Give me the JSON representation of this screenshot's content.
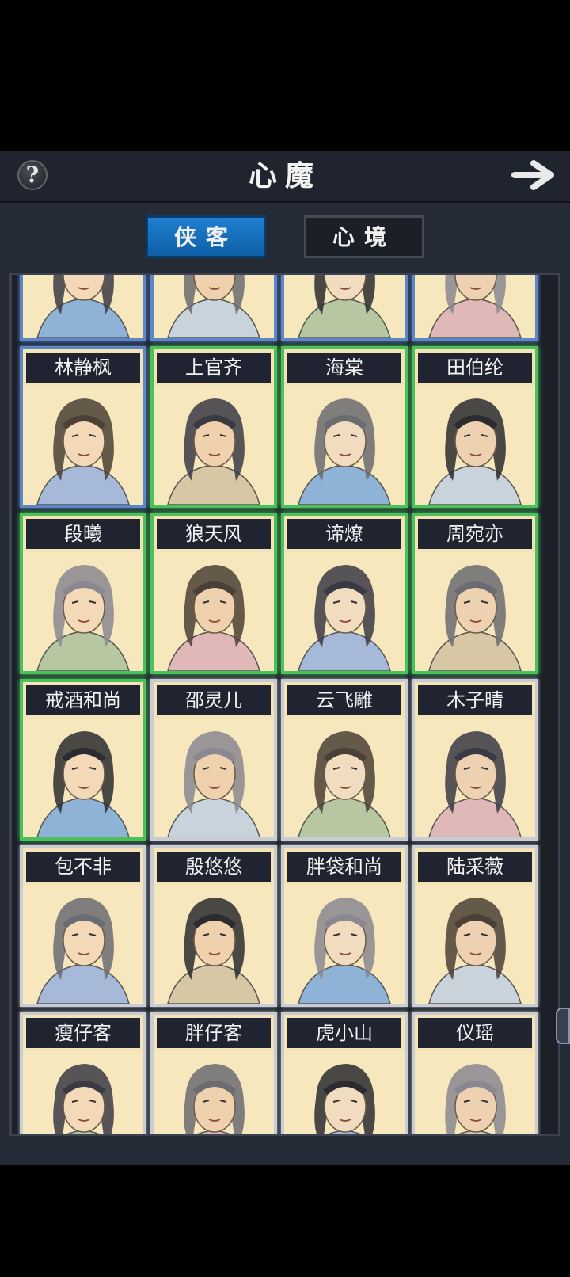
{
  "header": {
    "title": "心魔",
    "help_icon": "question-icon",
    "next_icon": "arrow-right-icon",
    "help_label": "?"
  },
  "tabs": [
    {
      "label": "侠客",
      "active": true
    },
    {
      "label": "心境",
      "active": false
    }
  ],
  "characters": [
    {
      "name": "",
      "frame": "blue"
    },
    {
      "name": "",
      "frame": "blue"
    },
    {
      "name": "",
      "frame": "blue"
    },
    {
      "name": "",
      "frame": "blue"
    },
    {
      "name": "林静枫",
      "frame": "blue"
    },
    {
      "name": "上官齐",
      "frame": "green"
    },
    {
      "name": "海棠",
      "frame": "green"
    },
    {
      "name": "田伯纶",
      "frame": "green"
    },
    {
      "name": "段曦",
      "frame": "green"
    },
    {
      "name": "狼天风",
      "frame": "green"
    },
    {
      "name": "谛燎",
      "frame": "green"
    },
    {
      "name": "周宛亦",
      "frame": "green"
    },
    {
      "name": "戒酒和尚",
      "frame": "green"
    },
    {
      "name": "邵灵儿",
      "frame": "gray"
    },
    {
      "name": "云飞雕",
      "frame": "gray"
    },
    {
      "name": "木子晴",
      "frame": "gray"
    },
    {
      "name": "包不非",
      "frame": "gray"
    },
    {
      "name": "殷悠悠",
      "frame": "gray"
    },
    {
      "name": "胖袋和尚",
      "frame": "gray"
    },
    {
      "name": "陆采薇",
      "frame": "gray"
    },
    {
      "name": "瘦仔客",
      "frame": "gray"
    },
    {
      "name": "胖仔客",
      "frame": "gray"
    },
    {
      "name": "虎小山",
      "frame": "gray"
    },
    {
      "name": "仪瑶",
      "frame": "gray"
    }
  ]
}
